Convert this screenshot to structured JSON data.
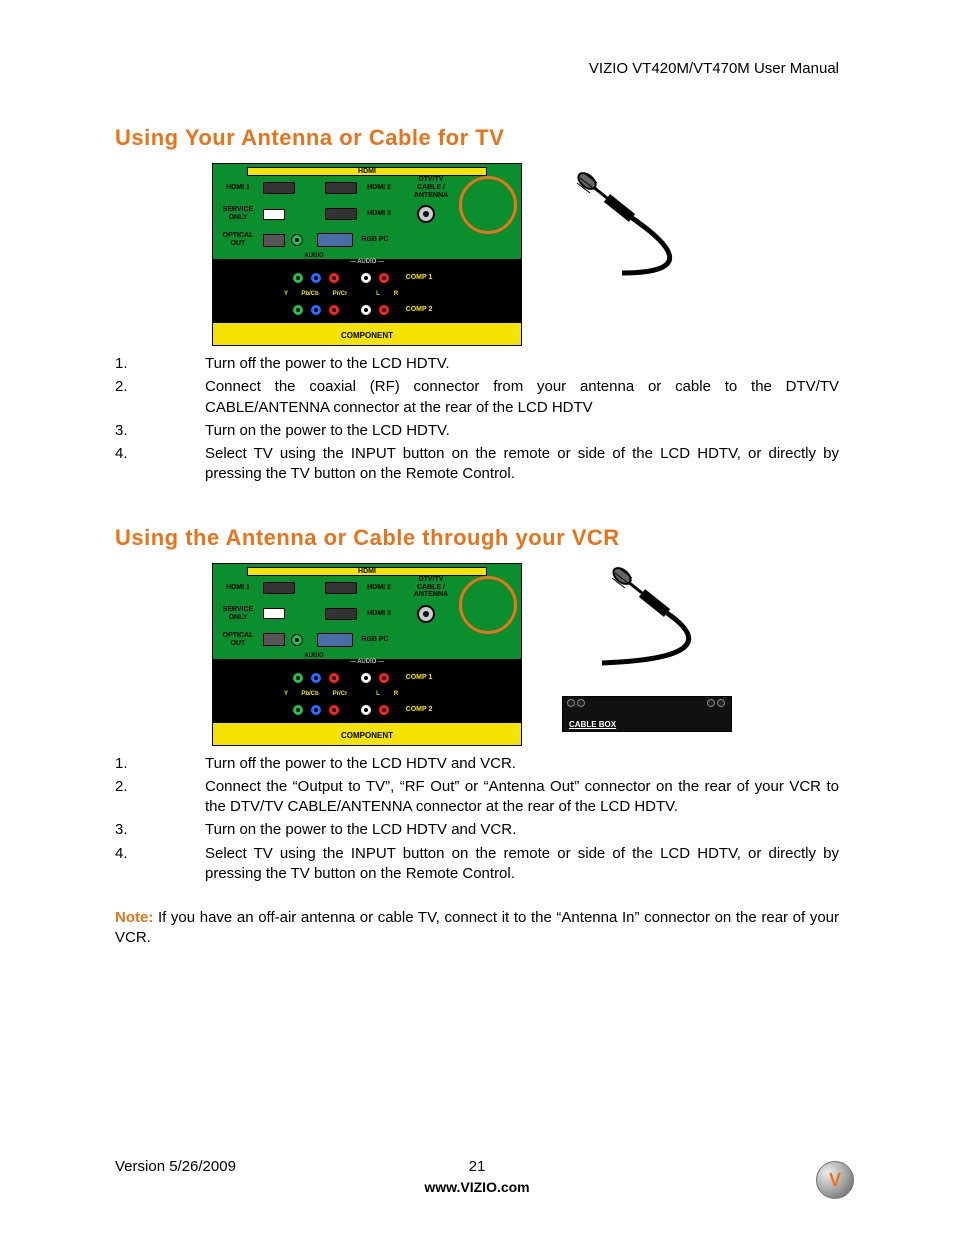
{
  "header": {
    "manual_title": "VIZIO VT420M/VT470M User Manual"
  },
  "section1": {
    "heading": "Using Your Antenna or Cable for TV",
    "steps": [
      "Turn off the power to the LCD HDTV.",
      "Connect the coaxial (RF) connector from your antenna or cable to the DTV/TV CABLE/ANTENNA connector at the rear of the LCD HDTV",
      "Turn on the power to the LCD HDTV.",
      "Select TV using the INPUT button on the remote or side of the LCD HDTV, or directly by pressing the TV button on the Remote Control."
    ]
  },
  "section2": {
    "heading": "Using the Antenna or Cable through your VCR",
    "steps": [
      "Turn off the power to the LCD HDTV and VCR.",
      "Connect the “Output to TV”, “RF Out” or “Antenna Out” connector on the rear of your VCR to the DTV/TV CABLE/ANTENNA connector at the rear of the LCD HDTV.",
      "Turn on the power to the LCD HDTV and VCR.",
      "Select TV using the INPUT button on the remote or side of the LCD HDTV, or directly by pressing the TV button on the Remote Control."
    ]
  },
  "note": {
    "label": "Note:",
    "text": " If you have an off-air antenna or cable TV, connect it to the “Antenna In” connector on the rear of your VCR."
  },
  "panel": {
    "hdmi_header": "HDMI",
    "hdmi1": "HDMI 1",
    "hdmi2": "HDMI 2",
    "hdmi3": "HDMI 3",
    "service": "SERVICE\nONLY",
    "optical": "OPTICAL\nOUT",
    "audio_small": "AUDIO",
    "rgbpc": "RGB PC",
    "dtv": "DTV/TV\nCABLE / ANTENNA",
    "audio_header": "AUDIO",
    "y": "Y",
    "pb": "Pb/Cb",
    "pr": "Pr/Cr",
    "l": "L",
    "r": "R",
    "comp1": "COMP 1",
    "comp2": "COMP 2",
    "component": "COMPONENT"
  },
  "vcr": {
    "label": "CABLE BOX"
  },
  "footer": {
    "version": "Version 5/26/2009",
    "page": "21",
    "url": "www.VIZIO.com"
  },
  "logo": {
    "letter": "V"
  }
}
